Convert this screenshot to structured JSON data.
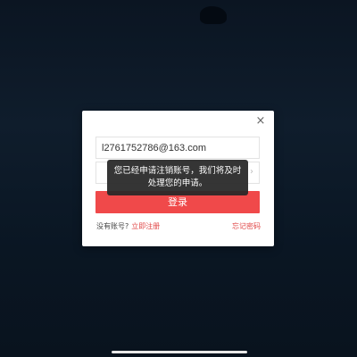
{
  "dialog": {
    "close_label": "×",
    "email_value": "l2761752786@163.com",
    "password_placeholder": "",
    "login_label": "登录",
    "no_account_text": "没有账号?",
    "register_link": "立即注册",
    "forgot_link": "忘记密码"
  },
  "toast": {
    "message": "您已经申请注销账号，我们将及时处理您的申请。"
  },
  "colors": {
    "accent": "#f0494a",
    "link": "#e14646",
    "background": "#0b1522"
  }
}
